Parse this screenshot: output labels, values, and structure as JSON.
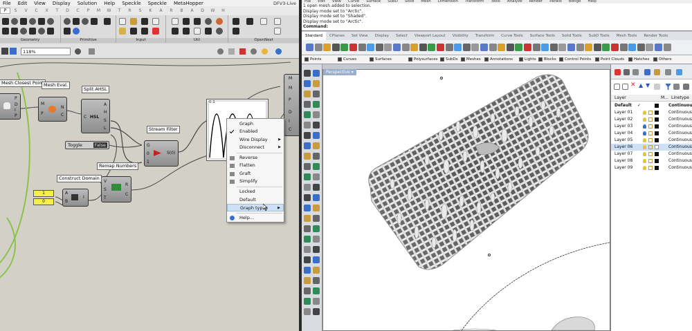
{
  "gh": {
    "menu": [
      "File",
      "Edit",
      "View",
      "Display",
      "Solution",
      "Help",
      "Speckle",
      "Speckle",
      "MetaHopper"
    ],
    "window_title": "DFV3-Live",
    "tabs": [
      "P",
      "S",
      "V",
      "C",
      "X",
      "T",
      "D",
      "C",
      "P",
      "M",
      "W",
      "T",
      "R",
      "S",
      "K",
      "A",
      "R",
      "B",
      "A",
      "D",
      "W",
      "H"
    ],
    "ribbon_groups": [
      "Geometry",
      "Primitive",
      "Input",
      "Util",
      "OpenNest"
    ],
    "zoom": "118%",
    "nodes": {
      "mesh_closest_point": "Mesh Closest Point",
      "mesh_eval": "Mesh Eval.",
      "split_ahsl": "Split AHSL",
      "stream_filter": "Stream Filter",
      "remap_numbers": "Remap Numbers",
      "construct_domain": "Construct Domain",
      "toggle_label": "Toggle",
      "toggle_value": "False",
      "split_center": "HSL",
      "stream_center": "S(0)",
      "graph_top": "0.1",
      "num_1": "1",
      "num_0": "0"
    },
    "pins": {
      "mcp": [
        "P",
        "D",
        "I",
        "P"
      ],
      "me_in": [
        "M",
        "P"
      ],
      "me_out": [
        "N",
        "C"
      ],
      "split_in": "C",
      "split_out": [
        "A",
        "H",
        "S",
        "L"
      ],
      "sf_in": [
        "G",
        "0",
        "1"
      ],
      "rn_in": [
        "V",
        "S",
        "T"
      ],
      "rn_out": [
        "R",
        "C"
      ],
      "cd_in": [
        "A",
        "B"
      ],
      "cd_out": "I",
      "panel_right": [
        "M",
        "M",
        "P",
        "D",
        "I",
        "C"
      ]
    },
    "context_menu": {
      "items": [
        "Graph",
        "Enabled",
        "Wire Display",
        "Disconnect",
        "Reverse",
        "Flatten",
        "Graft",
        "Simplify",
        "Locked",
        "Default",
        "Graph types",
        "Help..."
      ],
      "highlighted": "Graph types"
    }
  },
  "rhino": {
    "menu": [
      "File",
      "Edit",
      "View",
      "Curve",
      "Surface",
      "SubD",
      "Solid",
      "Mesh",
      "Dimension",
      "Transform",
      "Tools",
      "Analyze",
      "Render",
      "Panels",
      "Bongo",
      "Help"
    ],
    "command_history": [
      "1 open mesh added to selection.",
      "Display mode set to \"Arctic\".",
      "Display mode set to \"Shaded\".",
      "Display mode set to \"Arctic\"."
    ],
    "command_prompt": "Command:",
    "tabs": [
      "Standard",
      "CPlanes",
      "Set View",
      "Display",
      "Select",
      "Viewport Layout",
      "Visibility",
      "Transform",
      "Curve Tools",
      "Surface Tools",
      "Solid Tools",
      "SubD Tools",
      "Mesh Tools",
      "Render Tools"
    ],
    "osnaps": [
      "Points",
      "Curves",
      "Surfaces",
      "Polysurfaces",
      "SubDs",
      "Meshes",
      "Annotations",
      "Lights",
      "Blocks",
      "Control Points",
      "Point Clouds",
      "Hatches",
      "Others"
    ],
    "viewport": "Perspective",
    "layers": {
      "headers": [
        "Layer",
        "M...",
        "Linetype"
      ],
      "rows": [
        {
          "name": "Default",
          "linetype": "Continuous",
          "current": true
        },
        {
          "name": "Layer 01",
          "linetype": "Continuous"
        },
        {
          "name": "Layer 02",
          "linetype": "Continuous"
        },
        {
          "name": "Layer 03",
          "linetype": "Continuous"
        },
        {
          "name": "Layer 04",
          "linetype": "Continuous"
        },
        {
          "name": "Layer 05",
          "linetype": "Continuous"
        },
        {
          "name": "Layer 06",
          "linetype": "Continuous",
          "selected": true
        },
        {
          "name": "Layer 07",
          "linetype": "Continuous"
        },
        {
          "name": "Layer 08",
          "linetype": "Continuous"
        },
        {
          "name": "Layer 09",
          "linetype": "Continuous"
        }
      ]
    }
  },
  "colors": {
    "gh_canvas": "#d3d0c7",
    "highlight": "#cde0f5",
    "layer_selected": "#cfe0f6",
    "wire_green": "#8bc34a",
    "panel_yellow": "#f5ef4a"
  }
}
